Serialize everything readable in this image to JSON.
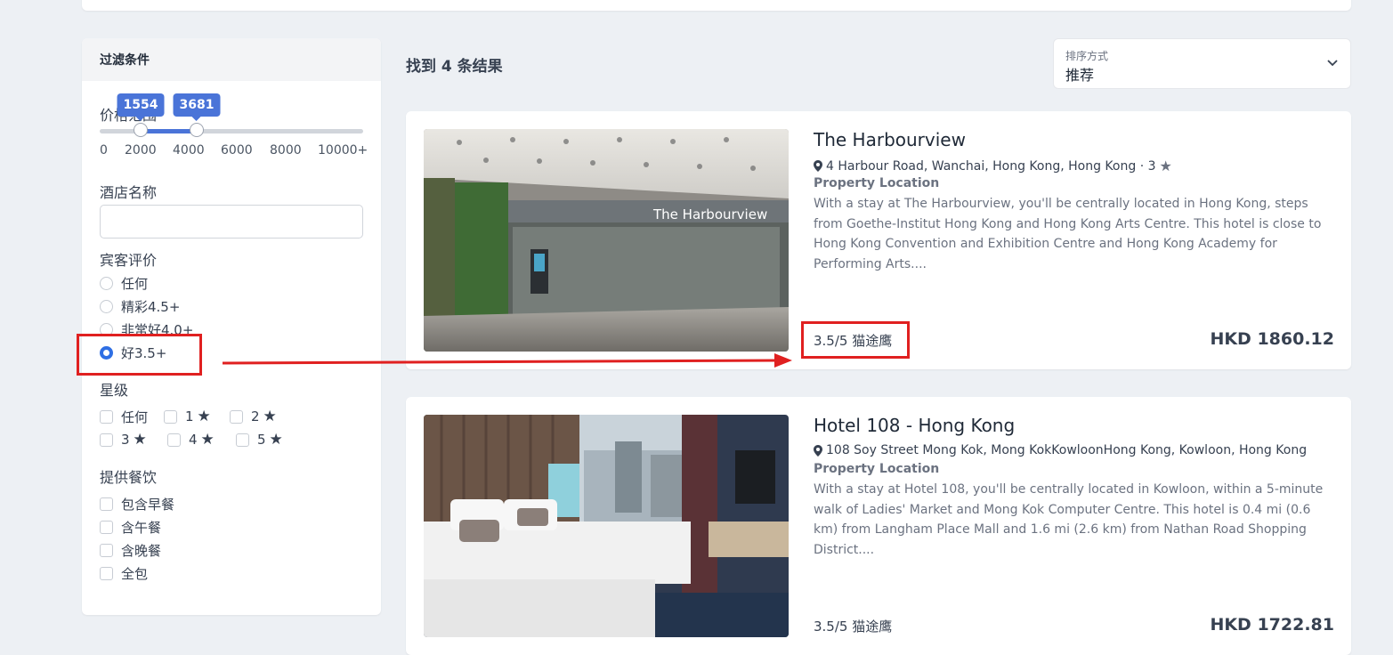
{
  "sidebar": {
    "title": "过滤条件",
    "price": {
      "label": "价格范围",
      "min_value": "1554",
      "max_value": "3681",
      "selected_range": [
        1554,
        3681
      ],
      "scale_max": 10000,
      "ticks": [
        "0",
        "2000",
        "4000",
        "6000",
        "8000",
        "10000+"
      ]
    },
    "hotel_name": {
      "label": "酒店名称",
      "value": ""
    },
    "guest_rating": {
      "label": "宾客评价",
      "options": [
        "任何",
        "精彩4.5+",
        "非常好4.0+",
        "好3.5+"
      ],
      "selected": "好3.5+"
    },
    "star_level": {
      "label": "星级",
      "options": [
        "任何",
        "1",
        "2",
        "3",
        "4",
        "5"
      ]
    },
    "meals": {
      "label": "提供餐饮",
      "options": [
        "包含早餐",
        "含午餐",
        "含晚餐",
        "全包"
      ]
    }
  },
  "results": {
    "count_text": "找到 4 条结果",
    "sort": {
      "label": "排序方式",
      "value": "推荐"
    },
    "hotels": [
      {
        "name": "The Harbourview",
        "address": "4 Harbour Road, Wanchai, Hong Kong, Hong Kong · 3",
        "section_label": "Property Location",
        "description": "With a stay at The Harbourview, you'll be centrally located in Hong Kong, steps from Goethe-Institut Hong Kong and Hong Kong Arts Centre. This hotel is close to Hong Kong Convention and Exhibition Centre and Hong Kong Academy for Performing Arts....",
        "rating": "3.5/5 猫途鹰",
        "price": "HKD 1860.12",
        "image_sign": "The Harbourview"
      },
      {
        "name": "Hotel 108 - Hong Kong",
        "address": "108 Soy Street Mong Kok, Mong KokKowloonHong Kong, Kowloon, Hong Kong",
        "section_label": "Property Location",
        "description": "With a stay at Hotel 108, you'll be centrally located in Kowloon, within a 5-minute walk of Ladies' Market and Mong Kok Computer Centre. This hotel is 0.4 mi (0.6 km) from Langham Place Mall and 1.6 mi (2.6 km) from Nathan Road Shopping District....",
        "rating": "3.5/5 猫途鹰",
        "price": "HKD 1722.81"
      }
    ]
  },
  "colors": {
    "accent": "#4a74d8",
    "annotation": "#e02020",
    "background": "#edf0f4"
  }
}
